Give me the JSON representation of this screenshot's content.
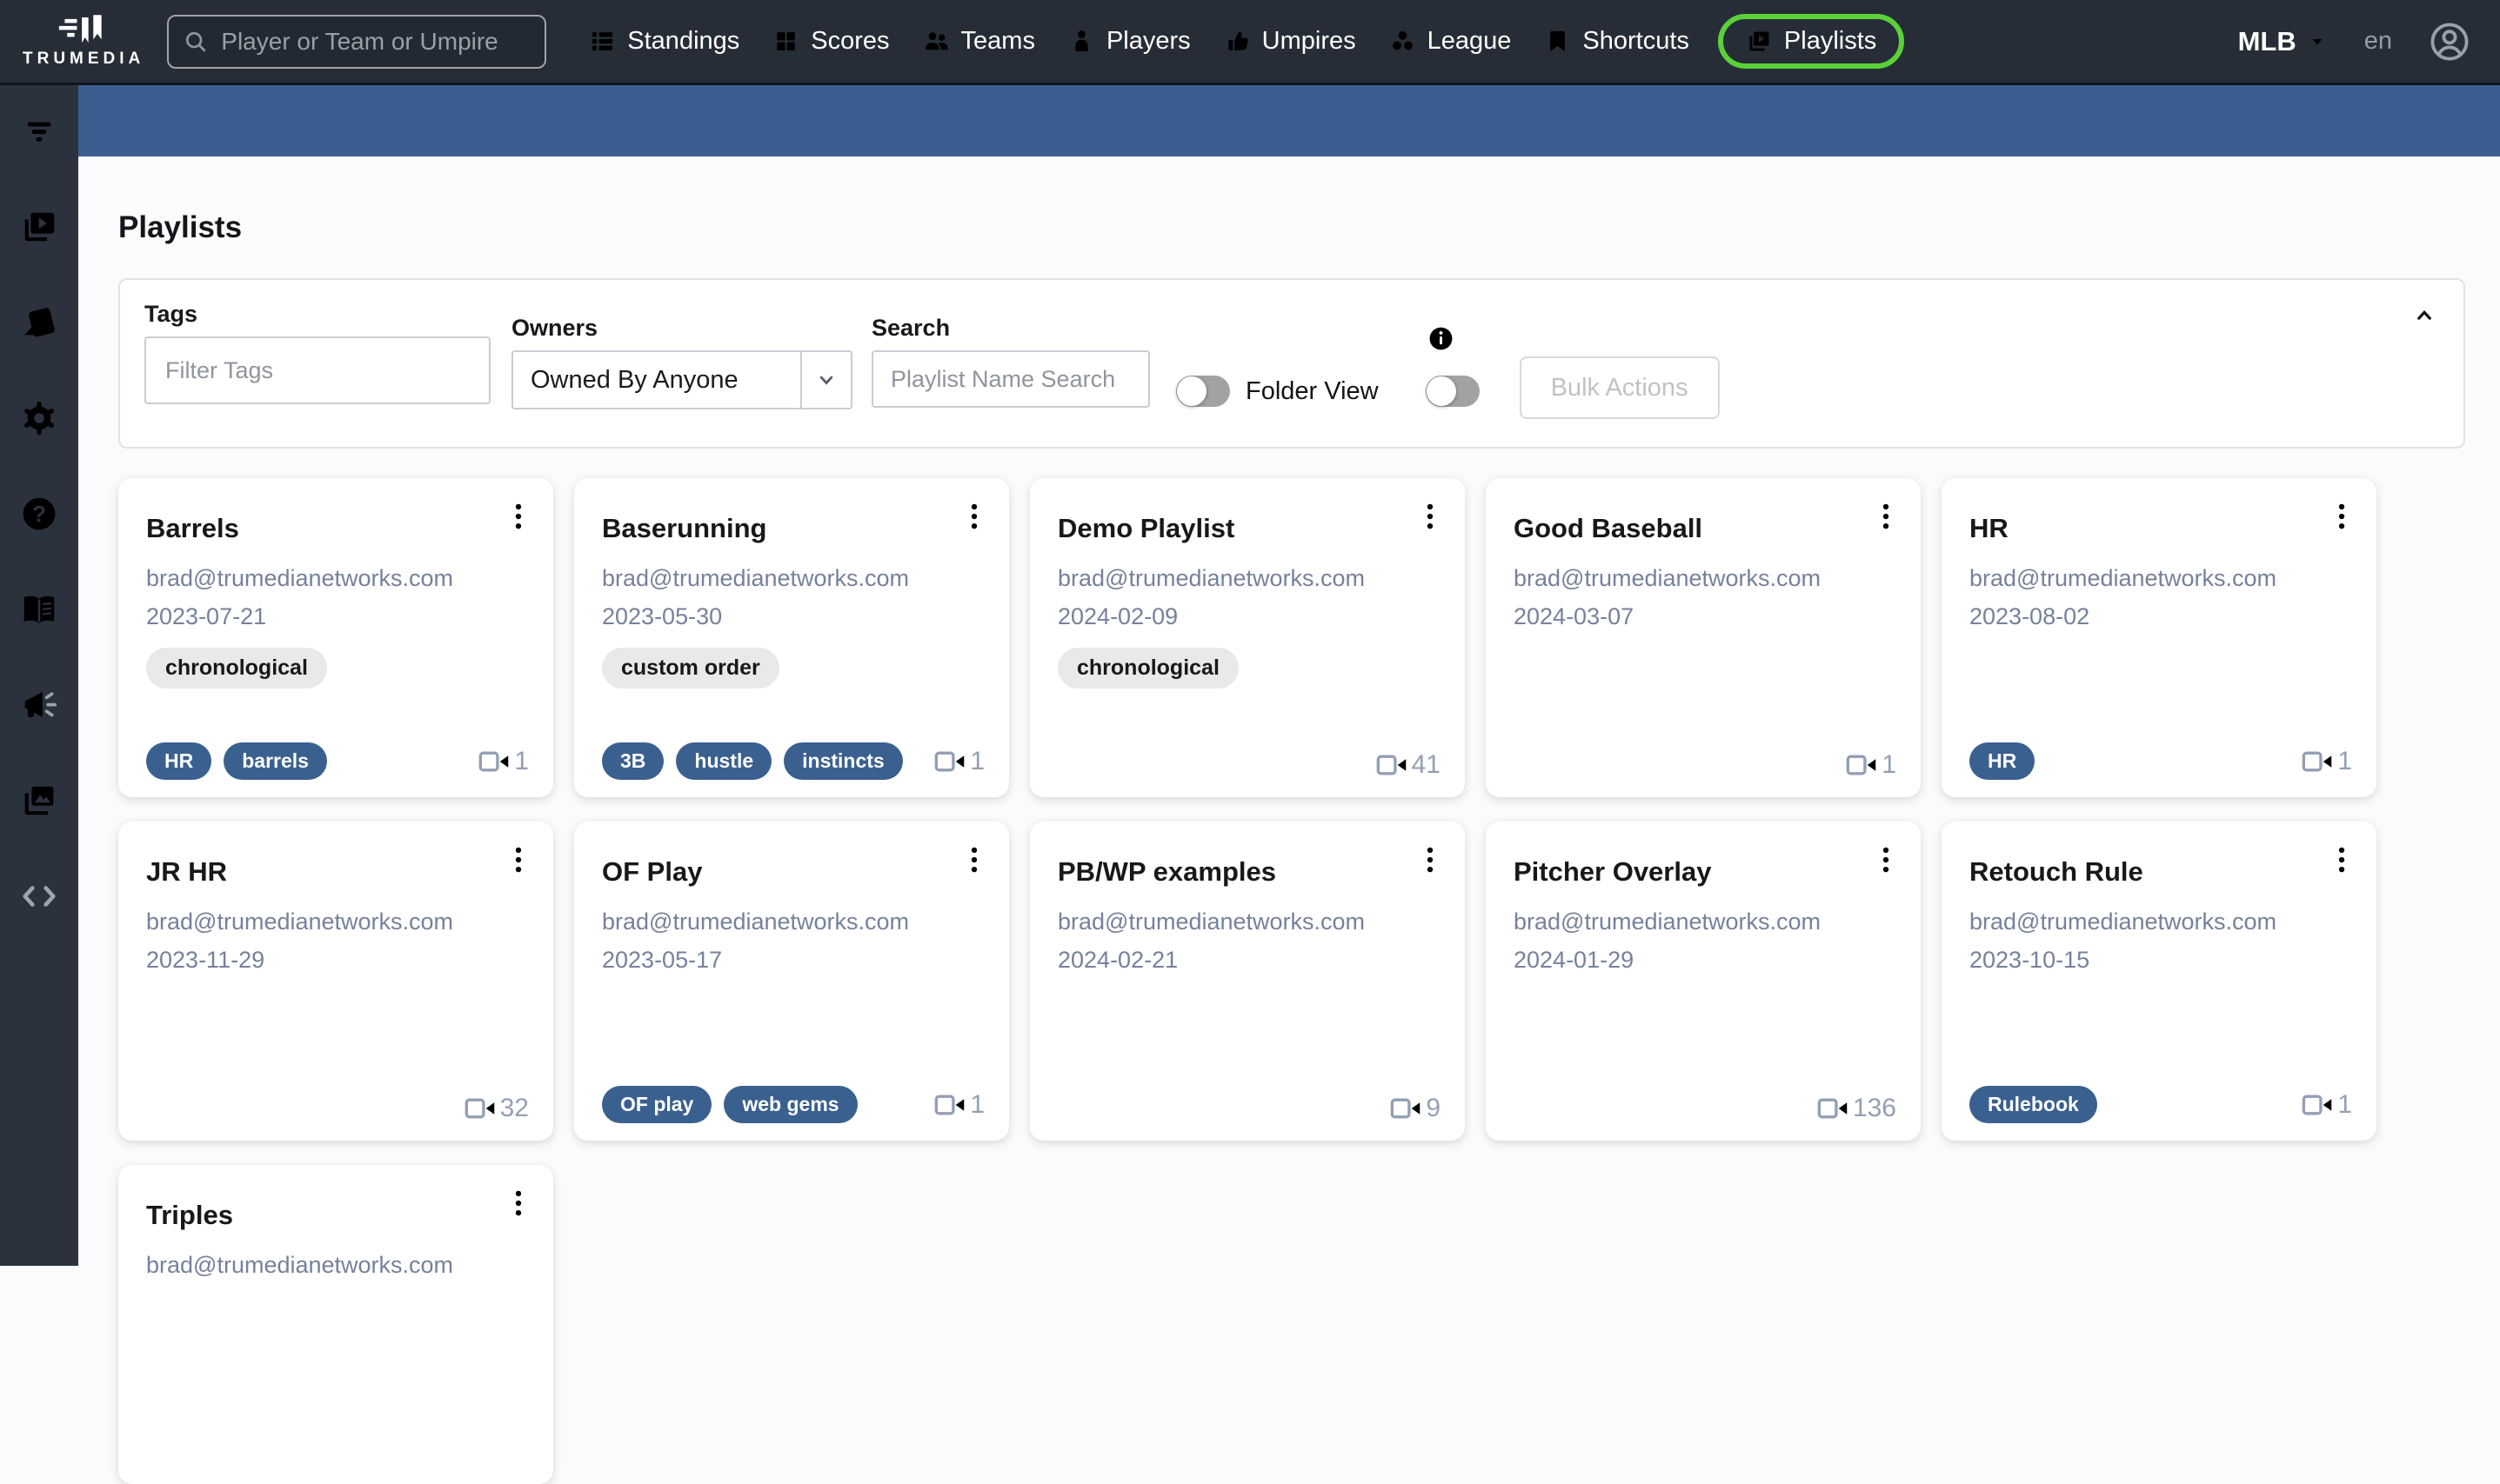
{
  "topnav": {
    "brand": "TRUMEDIA",
    "search_placeholder": "Player or Team or Umpire",
    "items": [
      {
        "id": "standings",
        "label": "Standings",
        "active": false
      },
      {
        "id": "scores",
        "label": "Scores",
        "active": false
      },
      {
        "id": "teams",
        "label": "Teams",
        "active": false
      },
      {
        "id": "players",
        "label": "Players",
        "active": false
      },
      {
        "id": "umpires",
        "label": "Umpires",
        "active": false
      },
      {
        "id": "league",
        "label": "League",
        "active": false
      },
      {
        "id": "shortcuts",
        "label": "Shortcuts",
        "active": false
      },
      {
        "id": "playlists",
        "label": "Playlists",
        "active": true
      }
    ],
    "league_selector": "MLB",
    "language": "en"
  },
  "sidebar": {
    "items": [
      {
        "id": "filter",
        "name": "filter-icon"
      },
      {
        "id": "video",
        "name": "video-playlists-icon"
      },
      {
        "id": "cards",
        "name": "cards-deck-icon"
      },
      {
        "id": "gear",
        "name": "settings-gear-icon"
      },
      {
        "id": "help",
        "name": "help-question-icon"
      },
      {
        "id": "book",
        "name": "docs-book-icon"
      },
      {
        "id": "megaphone",
        "name": "announcements-megaphone-icon"
      },
      {
        "id": "images",
        "name": "media-images-icon"
      },
      {
        "id": "code",
        "name": "embed-code-icon"
      }
    ]
  },
  "page": {
    "title": "Playlists"
  },
  "filters": {
    "tags_label": "Tags",
    "tags_placeholder": "Filter Tags",
    "owners_label": "Owners",
    "owners_value": "Owned By Anyone",
    "search_label": "Search",
    "search_placeholder": "Playlist Name Search",
    "folder_view_label": "Folder View",
    "folder_view_on": false,
    "bulk_actions_label": "Bulk Actions",
    "bulk_actions_on": false
  },
  "playlists": [
    {
      "name": "Barrels",
      "owner": "brad@trumedianetworks.com",
      "date": "2023-07-21",
      "sort_tag": "chronological",
      "tags": [
        "HR",
        "barrels"
      ],
      "count": "1"
    },
    {
      "name": "Baserunning",
      "owner": "brad@trumedianetworks.com",
      "date": "2023-05-30",
      "sort_tag": "custom order",
      "tags": [
        "3B",
        "hustle",
        "instincts"
      ],
      "count": "1"
    },
    {
      "name": "Demo Playlist",
      "owner": "brad@trumedianetworks.com",
      "date": "2024-02-09",
      "sort_tag": "chronological",
      "tags": [],
      "count": "41"
    },
    {
      "name": "Good Baseball",
      "owner": "brad@trumedianetworks.com",
      "date": "2024-03-07",
      "sort_tag": null,
      "tags": [],
      "count": "1"
    },
    {
      "name": "HR",
      "owner": "brad@trumedianetworks.com",
      "date": "2023-08-02",
      "sort_tag": null,
      "tags": [
        "HR"
      ],
      "count": "1"
    },
    {
      "name": "JR HR",
      "owner": "brad@trumedianetworks.com",
      "date": "2023-11-29",
      "sort_tag": null,
      "tags": [],
      "count": "32"
    },
    {
      "name": "OF Play",
      "owner": "brad@trumedianetworks.com",
      "date": "2023-05-17",
      "sort_tag": null,
      "tags": [
        "OF play",
        "web gems"
      ],
      "count": "1"
    },
    {
      "name": "PB/WP examples",
      "owner": "brad@trumedianetworks.com",
      "date": "2024-02-21",
      "sort_tag": null,
      "tags": [],
      "count": "9"
    },
    {
      "name": "Pitcher Overlay",
      "owner": "brad@trumedianetworks.com",
      "date": "2024-01-29",
      "sort_tag": null,
      "tags": [],
      "count": "136"
    },
    {
      "name": "Retouch Rule",
      "owner": "brad@trumedianetworks.com",
      "date": "2023-10-15",
      "sort_tag": null,
      "tags": [
        "Rulebook"
      ],
      "count": "1"
    },
    {
      "name": "Triples",
      "owner": "brad@trumedianetworks.com",
      "date": null,
      "sort_tag": null,
      "tags": [],
      "count": null
    }
  ],
  "colors": {
    "nav_bg": "#262D37",
    "side_bg": "#2B323D",
    "band_blue": "#3A5E8F",
    "accent_green": "#5BD139",
    "tag_blue": "#3A608F",
    "info_blue": "#2D5C8F"
  }
}
